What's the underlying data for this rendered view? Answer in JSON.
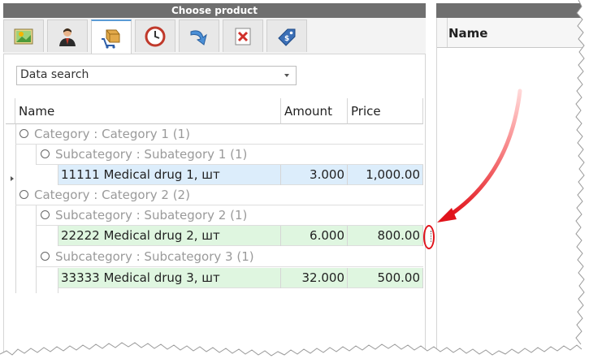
{
  "panel": {
    "title": "Choose product"
  },
  "toolbar": {
    "tabs": [
      {
        "name": "picture-icon"
      },
      {
        "name": "person-icon"
      },
      {
        "name": "box-cart-icon"
      },
      {
        "name": "clock-icon"
      },
      {
        "name": "redo-arrow-icon"
      },
      {
        "name": "delete-icon"
      },
      {
        "name": "price-tag-icon"
      }
    ],
    "active_tab_index": 2
  },
  "search": {
    "value": "Data search"
  },
  "grid": {
    "columns": {
      "name": "Name",
      "amount": "Amount",
      "price": "Price"
    },
    "groups": [
      {
        "label": "Category : Category 1 (1)",
        "subgroups": [
          {
            "label": "Subcategory : Subategory 1 (1)",
            "rows": [
              {
                "name": "11111 Medical drug 1, шт",
                "amount": "3.000",
                "price": "1,000.00",
                "selected": true
              }
            ]
          }
        ]
      },
      {
        "label": "Category : Category 2 (2)",
        "subgroups": [
          {
            "label": "Subcategory : Subategory 2 (1)",
            "rows": [
              {
                "name": "22222 Medical drug 2, шт",
                "amount": "6.000",
                "price": "800.00"
              }
            ]
          },
          {
            "label": "Subcategory : Subcategory 3 (1)",
            "rows": [
              {
                "name": "33333 Medical drug 3, шт",
                "amount": "32.000",
                "price": "500.00"
              }
            ]
          }
        ]
      }
    ]
  },
  "right_panel": {
    "column": "Name"
  },
  "colors": {
    "selected_row": "#dcedfb",
    "row": "#dff6e0",
    "annotation": "#e0131b",
    "title_bar": "#6f6f6f"
  }
}
